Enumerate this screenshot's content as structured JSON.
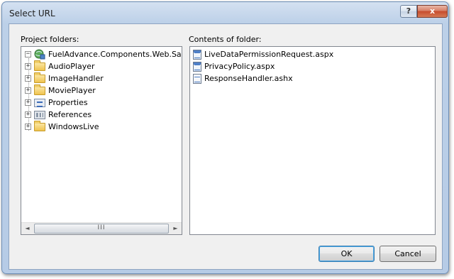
{
  "window": {
    "title": "Select URL",
    "help_label": "?",
    "close_label": "x"
  },
  "left": {
    "label": "Project folders:",
    "root": {
      "label": "FuelAdvance.Components.Web.Sam",
      "expander": "−"
    },
    "items": [
      {
        "label": "AudioPlayer",
        "icon": "folder-icon",
        "expander": "+"
      },
      {
        "label": "ImageHandler",
        "icon": "folder-icon",
        "expander": "+"
      },
      {
        "label": "MoviePlayer",
        "icon": "folder-icon",
        "expander": "+"
      },
      {
        "label": "Properties",
        "icon": "properties-icon",
        "expander": "+"
      },
      {
        "label": "References",
        "icon": "references-icon",
        "expander": "+"
      },
      {
        "label": "WindowsLive",
        "icon": "folder-icon",
        "expander": "+"
      }
    ],
    "scrollbar": {
      "left_arrow": "◄",
      "right_arrow": "►",
      "grip": "III"
    }
  },
  "right": {
    "label": "Contents of folder:",
    "files": [
      {
        "label": "LiveDataPermissionRequest.aspx",
        "icon": "aspx-file-icon"
      },
      {
        "label": "PrivacyPolicy.aspx",
        "icon": "aspx-file-icon"
      },
      {
        "label": "ResponseHandler.ashx",
        "icon": "ashx-file-icon"
      }
    ]
  },
  "buttons": {
    "ok": "OK",
    "cancel": "Cancel"
  }
}
